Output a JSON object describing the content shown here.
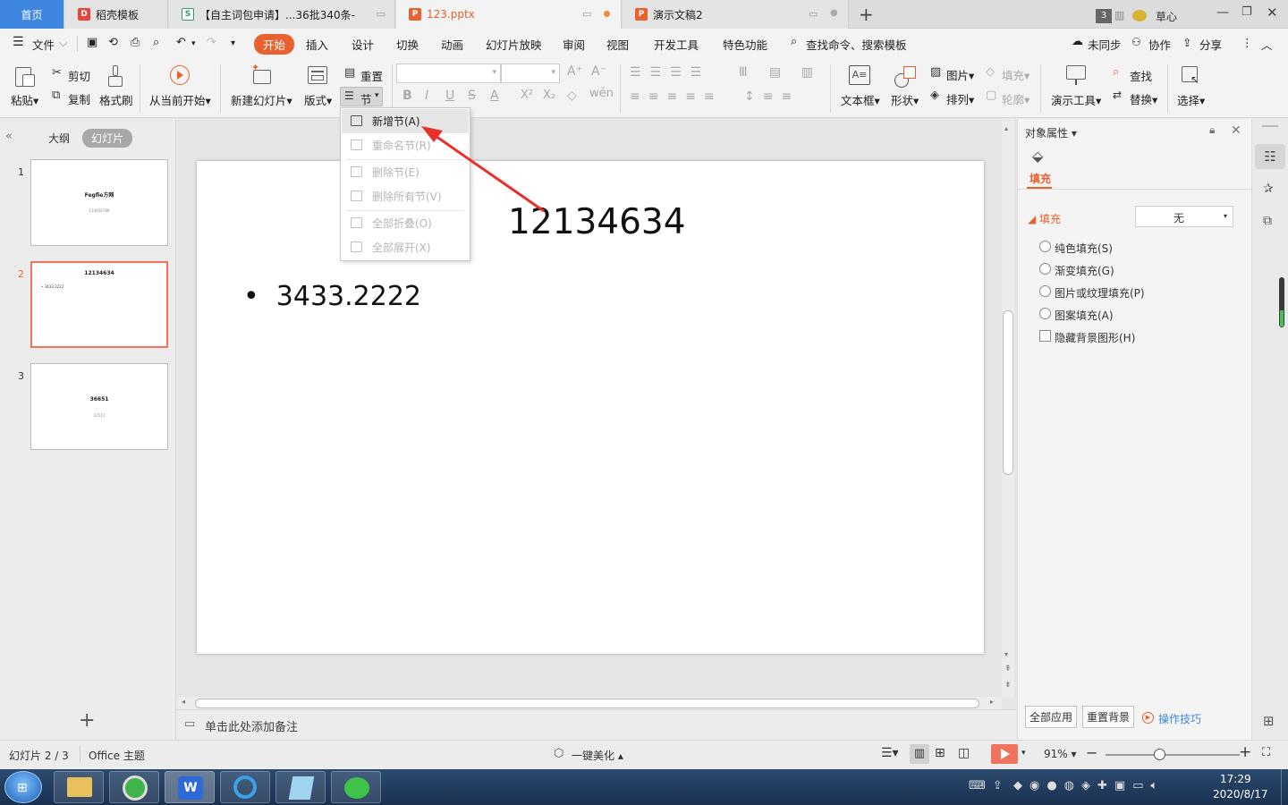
{
  "tabs": [
    {
      "label": "首页",
      "type": "home"
    },
    {
      "label": "稻壳模板",
      "icon": "docer-icon"
    },
    {
      "label": "【自主词包申请】...36批340条-",
      "icon": "sheet-icon"
    },
    {
      "label": "123.pptx",
      "icon": "ppt-icon",
      "active": true
    },
    {
      "label": "演示文稿2",
      "icon": "ppt-icon"
    }
  ],
  "window": {
    "badge": "3",
    "user": "草心"
  },
  "menu": {
    "file": "文件",
    "items": [
      "开始",
      "插入",
      "设计",
      "切换",
      "动画",
      "幻灯片放映",
      "审阅",
      "视图",
      "开发工具",
      "特色功能"
    ],
    "search": "查找命令、搜索模板",
    "sync": "未同步",
    "collab": "协作",
    "share": "分享"
  },
  "ribbon": {
    "paste": "粘贴",
    "cut": "剪切",
    "copy": "复制",
    "format_painter": "格式刷",
    "from_current": "从当前开始",
    "new_slide": "新建幻灯片",
    "layout": "版式",
    "reset": "重置",
    "section": "节",
    "textbox": "文本框",
    "shape": "形状",
    "picture": "图片",
    "arrange": "排列",
    "fill": "填充",
    "outline": "轮廓",
    "presentation_tools": "演示工具",
    "find": "查找",
    "replace": "替换",
    "select": "选择"
  },
  "section_menu": [
    {
      "label": "新增节(A)",
      "enabled": true,
      "highlighted": true
    },
    {
      "label": "重命名节(R)",
      "enabled": false
    },
    {
      "label": "删除节(E)",
      "enabled": false
    },
    {
      "label": "删除所有节(V)",
      "enabled": false
    },
    {
      "label": "全部折叠(O)",
      "enabled": false
    },
    {
      "label": "全部展开(X)",
      "enabled": false
    }
  ],
  "left_panel": {
    "tab_outline": "大纲",
    "tab_slides": "幻灯片",
    "slides": [
      {
        "num": "1",
        "title": "Fegfie方网",
        "sub": "123456789"
      },
      {
        "num": "2",
        "title": "12134634",
        "bullet": "3433.2222"
      },
      {
        "num": "3",
        "title": "36651",
        "sub": "22511"
      }
    ]
  },
  "slide": {
    "title": "12134634",
    "bullet": "3433.2222"
  },
  "notes": {
    "placeholder": "单击此处添加备注"
  },
  "right_panel": {
    "title": "对象属性",
    "tab": "填充",
    "fill_label": "填充",
    "fill_value": "无",
    "options": [
      "纯色填充(S)",
      "渐变填充(G)",
      "图片或纹理填充(P)",
      "图案填充(A)"
    ],
    "checkbox": "隐藏背景图形(H)",
    "apply_all": "全部应用",
    "reset_bg": "重置背景",
    "tips": "操作技巧"
  },
  "status": {
    "slide_info": "幻灯片 2 / 3",
    "theme": "Office 主题",
    "beautify": "一键美化",
    "zoom": "91%",
    "zoom_fraction": 0.4
  },
  "taskbar": {
    "time": "17:29",
    "date": "2020/8/17"
  },
  "colors": {
    "accent": "#e8612f",
    "home_tab": "#3f86e0",
    "arrow": "#e8302a",
    "play": "#f0735d"
  }
}
